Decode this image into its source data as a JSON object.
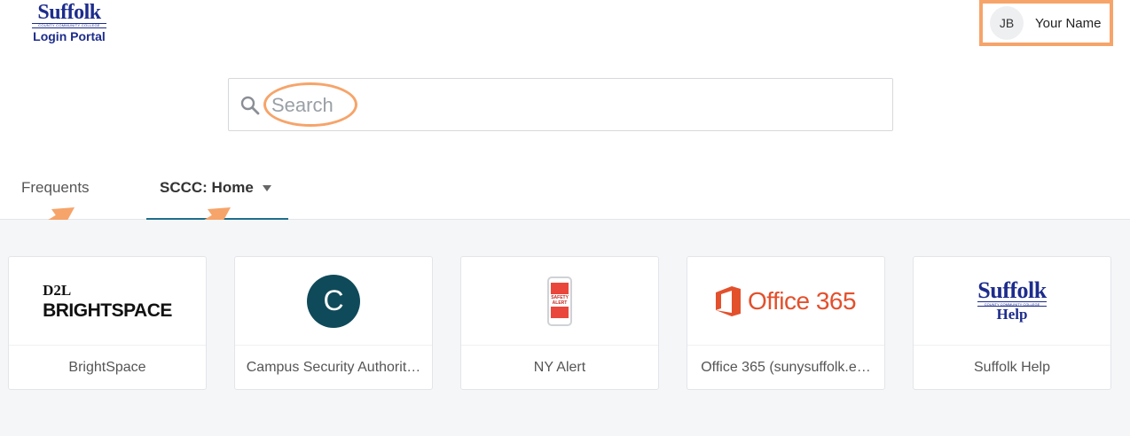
{
  "header": {
    "logo_wordmark": "Suffolk",
    "logo_college": "COUNTY COMMUNITY COLLEGE",
    "logo_subtitle": "Login Portal",
    "user_initials": "JB",
    "user_name": "Your Name"
  },
  "search": {
    "placeholder": "Search"
  },
  "tabs": [
    {
      "label": "Frequents",
      "active": false
    },
    {
      "label": "SCCC: Home",
      "active": true
    }
  ],
  "apps": [
    {
      "label": "BrightSpace",
      "logo_top": "D2L",
      "logo_bottom": "BRIGHTSPACE"
    },
    {
      "label": "Campus Security Authorit…",
      "logo_letter": "C"
    },
    {
      "label": "NY Alert",
      "logo_text": "SAFETY ALERT"
    },
    {
      "label": "Office 365 (sunysuffolk.e…",
      "logo_text": "Office 365"
    },
    {
      "label": "Suffolk Help",
      "logo_wordmark": "Suffolk",
      "logo_college": "COUNTY COMMUNITY COLLEGE",
      "logo_sub": "Help"
    }
  ],
  "colors": {
    "brand_navy": "#1d2c8c",
    "annotation_orange": "#f6a46a",
    "tab_underline": "#1f6e8c",
    "campus_circle": "#0f4a5a",
    "office_red": "#e3502c"
  }
}
